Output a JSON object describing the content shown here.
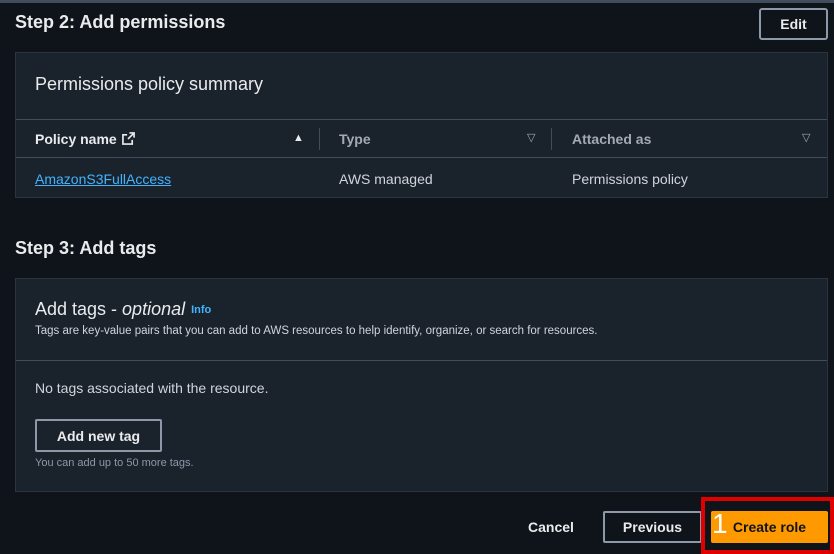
{
  "step2": {
    "title": "Step 2: Add permissions",
    "edit_label": "Edit",
    "panel_title": "Permissions policy summary",
    "columns": [
      "Policy name",
      "Type",
      "Attached as"
    ],
    "rows": [
      {
        "policy_name": "AmazonS3FullAccess",
        "type": "AWS managed",
        "attached_as": "Permissions policy"
      }
    ]
  },
  "step3": {
    "title": "Step 3: Add tags",
    "panel_title": "Add tags - ",
    "panel_title_optional": "optional",
    "info_label": "Info",
    "description": "Tags are key-value pairs that you can add to AWS resources to help identify, organize, or search for resources.",
    "empty_text": "No tags associated with the resource.",
    "add_tag_label": "Add new tag",
    "limit_text": "You can add up to 50 more tags."
  },
  "footer": {
    "cancel_label": "Cancel",
    "previous_label": "Previous",
    "create_label": "Create role"
  },
  "annotation": {
    "step_number": "1",
    "highlight_color": "#e00000"
  },
  "colors": {
    "accent": "#ff9900",
    "link": "#42b4ff",
    "background": "#0f141a",
    "panel": "#1a222c"
  },
  "icons": {
    "external_link": "external-link-icon",
    "sort_ascending": "sort-ascending-icon",
    "sort_dropdown": "caret-down-icon"
  }
}
